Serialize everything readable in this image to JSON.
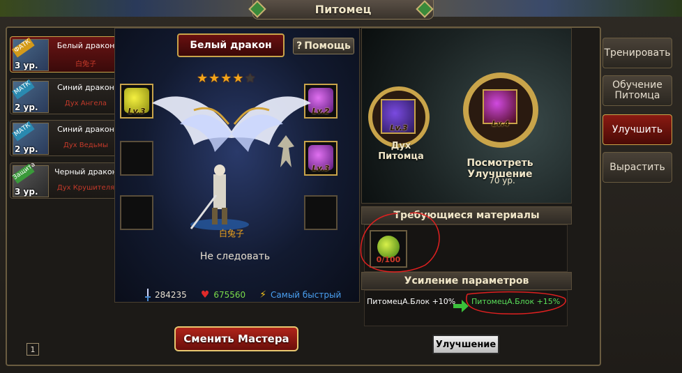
{
  "window": {
    "title": "Питомец"
  },
  "pets": [
    {
      "tag": "ФАТК",
      "level": "3 ур.",
      "name": "Белый дракон",
      "subtitle": "白兔子",
      "active": true
    },
    {
      "tag": "МАТК",
      "level": "2 ур.",
      "name": "Синий дракон",
      "subtitle": "Дух Ангела",
      "active": false
    },
    {
      "tag": "МАТК",
      "level": "2 ур.",
      "name": "Синий дракон",
      "subtitle": "Дух Ведьмы",
      "active": false
    },
    {
      "tag": "Защита",
      "level": "3 ур.",
      "name": "Черный дракон",
      "subtitle": "Дух Крушителя",
      "active": false
    }
  ],
  "pet_display": {
    "name": "Белый дракон",
    "help_label": "Помощь",
    "help_icon": "?",
    "stars_filled": 4,
    "stars_total": 5,
    "slots": [
      {
        "label": "Lv.3",
        "gem": "yellow"
      },
      {
        "label": "Lv.2",
        "gem": "purple"
      },
      {
        "label": "Lv.3",
        "gem": "purple"
      }
    ],
    "master_name": "白兔子",
    "follow_status": "Не следовать",
    "stats": {
      "power": "284235",
      "hp": "675560",
      "speed": "Самый быстрый"
    },
    "change_master_label": "Сменить Мастера"
  },
  "upgrade": {
    "current_label": "Lv.3",
    "next_label": "Lv.4",
    "spirit_label": "Дух Питомца",
    "view_upgrade_label": "Посмотреть Улучшение",
    "level_requirement": "70 ур.",
    "materials_header": "Требующиеся материалы",
    "material_count": "0/100",
    "bonus_header": "Усиление параметров",
    "bonus_current": "ПитомецА.Блок  +10%",
    "bonus_next": "ПитомецА.Блок  +15%",
    "upgrade_button": "Улучшение"
  },
  "side_tabs": [
    {
      "label": "Тренировать",
      "active": false
    },
    {
      "label": "Обучение Питомца",
      "active": false
    },
    {
      "label": "Улучшить",
      "active": true
    },
    {
      "label": "Вырастить",
      "active": false
    }
  ],
  "page_indicator": "1",
  "colors": {
    "accent_red": "#8a1a12",
    "gold": "#c9a44a",
    "bonus_green": "#5ae05a"
  }
}
